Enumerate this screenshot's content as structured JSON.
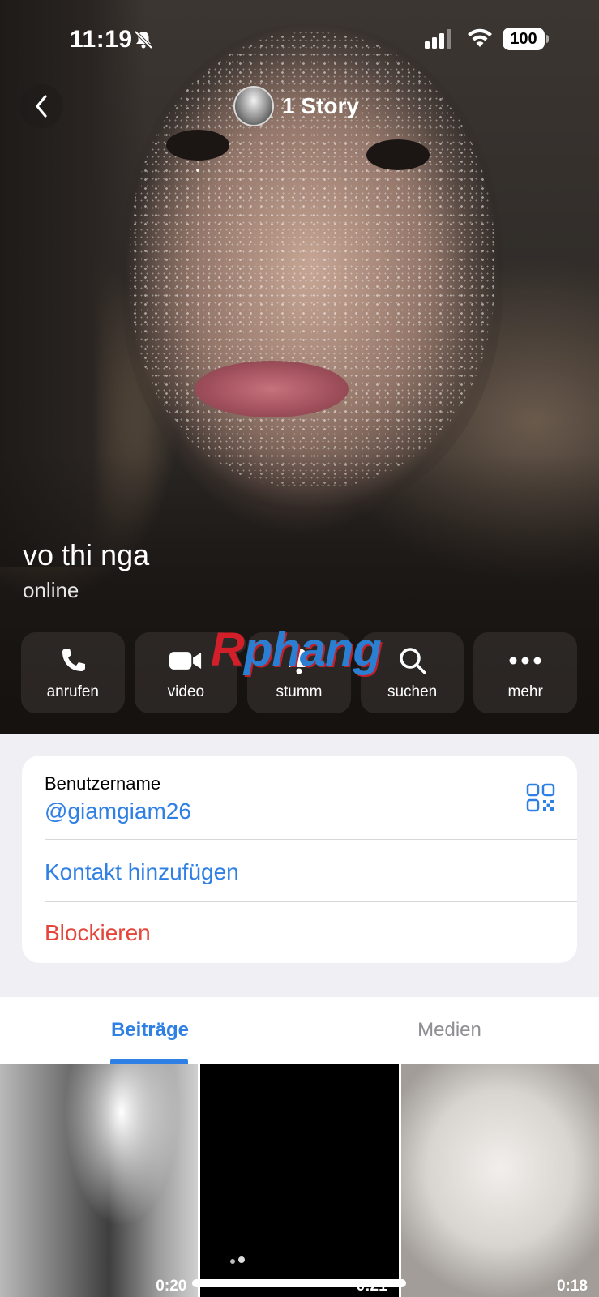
{
  "status_bar": {
    "time": "11:19",
    "battery": "100",
    "icons": [
      "bell-slash-icon",
      "cellular-signal-icon",
      "wifi-icon",
      "battery-icon"
    ]
  },
  "header": {
    "back_icon": "chevron-left-icon",
    "story_label": "1 Story"
  },
  "profile": {
    "name": "vo thi nga",
    "status": "online"
  },
  "watermark": {
    "first_letter": "R",
    "rest": "phang"
  },
  "actions": [
    {
      "icon": "phone-icon",
      "label": "anrufen"
    },
    {
      "icon": "video-camera-icon",
      "label": "video"
    },
    {
      "icon": "bell-icon",
      "label": "stumm"
    },
    {
      "icon": "search-icon",
      "label": "suchen"
    },
    {
      "icon": "ellipsis-icon",
      "label": "mehr"
    }
  ],
  "info": {
    "username_label": "Benutzername",
    "username_value": "@giamgiam26",
    "add_contact": "Kontakt hinzufügen",
    "block": "Blockieren",
    "qr_icon": "qr-code-icon"
  },
  "tabs": [
    {
      "label": "Beiträge",
      "active": true
    },
    {
      "label": "Medien",
      "active": false
    }
  ],
  "media": [
    {
      "duration": "0:20"
    },
    {
      "duration": "0:21"
    },
    {
      "duration": "0:18"
    }
  ],
  "colors": {
    "accent": "#2f80e4",
    "destructive": "#e5443a",
    "background": "#efeff4"
  }
}
